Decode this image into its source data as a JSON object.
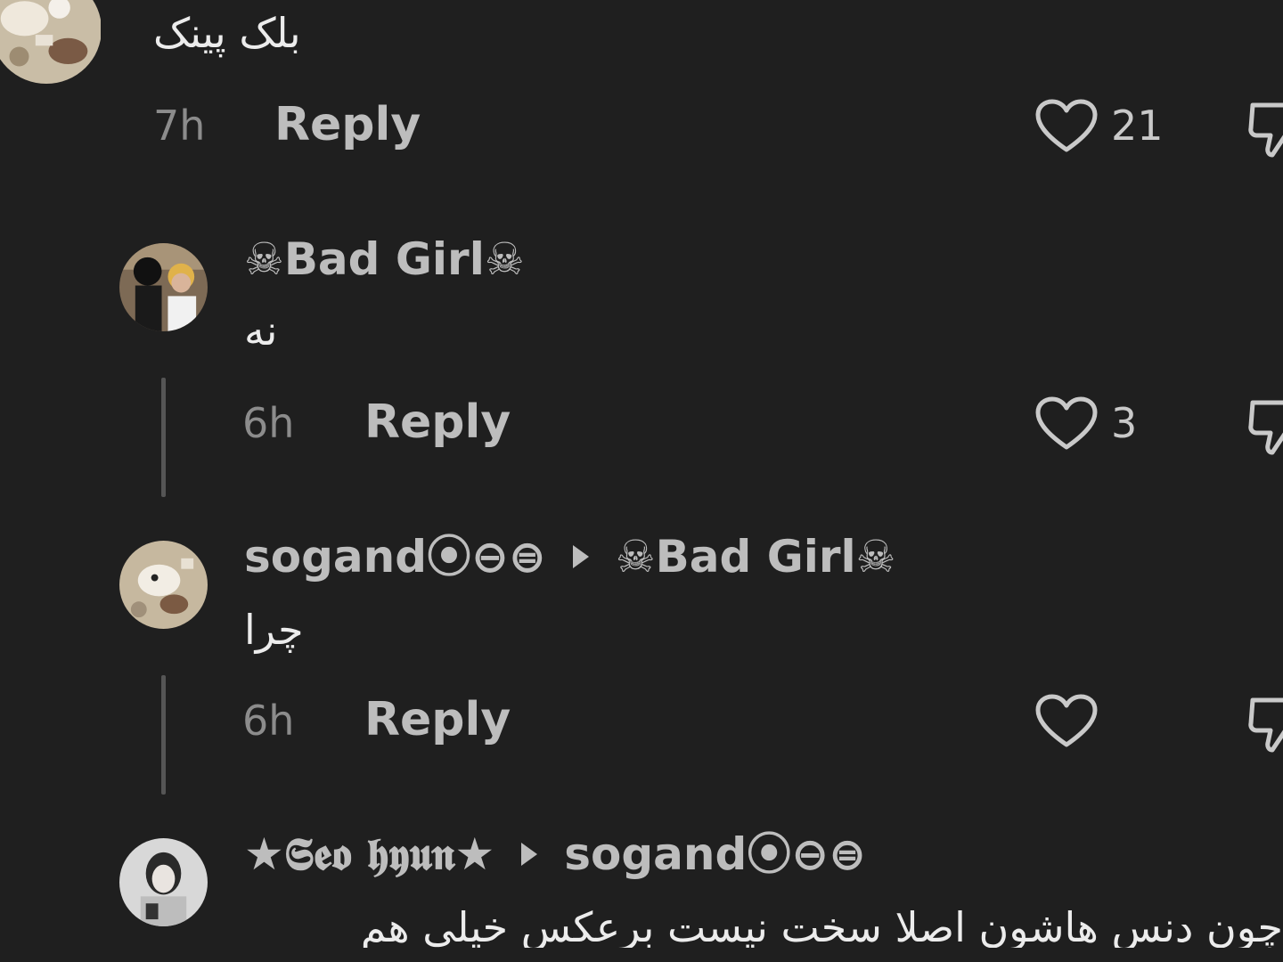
{
  "comments": [
    {
      "text": "بلک پینک",
      "time": "7h",
      "reply_label": "Reply",
      "likes": "21"
    },
    {
      "author": "☠Bad Girl☠",
      "text": "نه",
      "time": "6h",
      "reply_label": "Reply",
      "likes": "3"
    },
    {
      "author": "sogand⦿⊖⊜",
      "reply_to": "☠Bad Girl☠",
      "text": "چرا",
      "time": "6h",
      "reply_label": "Reply",
      "likes": ""
    },
    {
      "author": "★𝕾𝖊𝖔 𝖍𝖞𝖚𝖓★",
      "reply_to": "sogand⦿⊖⊜",
      "text": "چون دنس هاشون اصلا سخت نیست برعکس خیلی هم"
    }
  ],
  "icons": {
    "like": "heart-outline-icon",
    "dislike": "thumbs-down-icon",
    "reply_arrow": "caret-right-icon"
  },
  "colors": {
    "background": "#1f1f1f",
    "username": "#bdbdbd",
    "meta": "#8c8c8c"
  }
}
